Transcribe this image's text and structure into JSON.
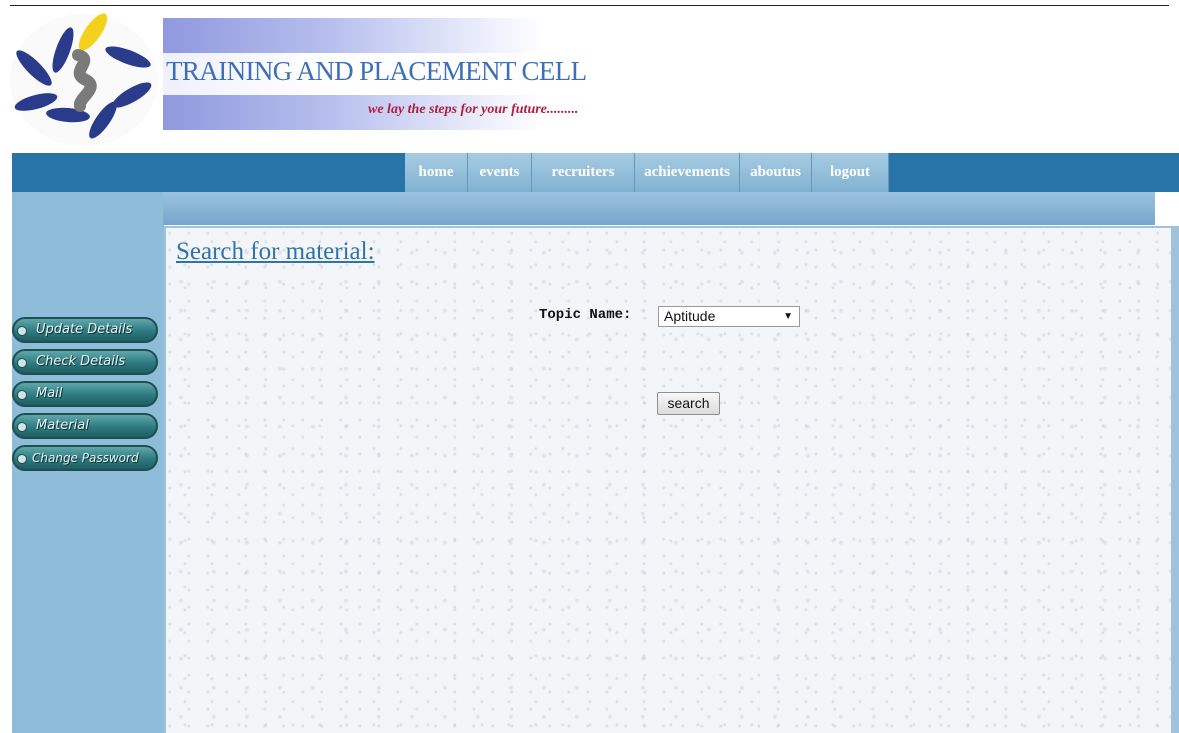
{
  "header": {
    "title": "TRAINING AND PLACEMENT CELL",
    "tagline": "we lay the steps for your future........."
  },
  "nav": {
    "items": [
      {
        "label": "home"
      },
      {
        "label": "events"
      },
      {
        "label": "recruiters"
      },
      {
        "label": "achievements"
      },
      {
        "label": "aboutus"
      },
      {
        "label": "logout"
      }
    ]
  },
  "sidebar": {
    "items": [
      {
        "label": "Update Details"
      },
      {
        "label": "Check Details"
      },
      {
        "label": "Mail"
      },
      {
        "label": "Material"
      },
      {
        "label": "Change Password"
      }
    ]
  },
  "main": {
    "heading": "Search for material:",
    "topic_label": "Topic Name:",
    "topic_value": "Aptitude",
    "search_label": "search"
  },
  "colors": {
    "nav_bar": "#2874a8",
    "sidebar": "#8fbcd9",
    "heading": "#2f74a9",
    "tagline": "#b01e3f",
    "title": "#3d6fb7"
  }
}
